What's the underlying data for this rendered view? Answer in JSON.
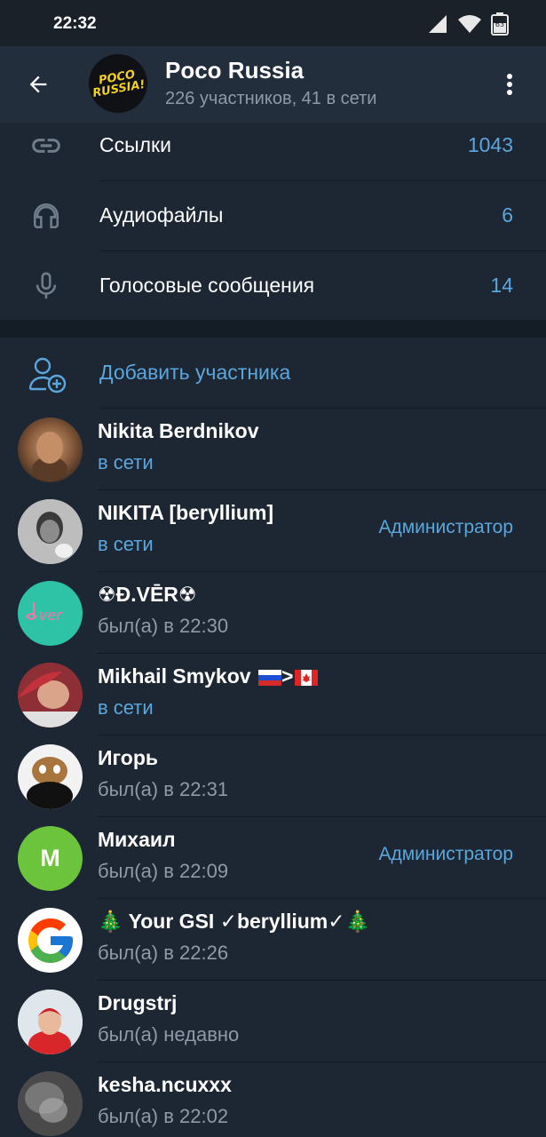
{
  "status_bar": {
    "time": "22:32",
    "battery": "63",
    "icons": [
      "signal-icon",
      "wifi-icon",
      "battery-icon"
    ]
  },
  "header": {
    "title": "Poco Russia",
    "subtitle": "226 участников, 41 в сети",
    "avatar_text_line1": "POCO",
    "avatar_text_line2": "RUSSIA!"
  },
  "media": [
    {
      "label": "Ссылки",
      "count": "1043",
      "icon": "link-icon"
    },
    {
      "label": "Аудиофайлы",
      "count": "6",
      "icon": "headphones-icon"
    },
    {
      "label": "Голосовые сообщения",
      "count": "14",
      "icon": "microphone-icon"
    }
  ],
  "add_member": {
    "label": "Добавить участника"
  },
  "members": [
    {
      "name": "Nikita Berdnikov",
      "status": "в сети",
      "online": true,
      "role": ""
    },
    {
      "name": "NIKITA [beryllium]",
      "status": "в сети",
      "online": true,
      "role": "Администратор"
    },
    {
      "name": "☢Đ.VĒR☢",
      "status": "был(а) в 22:30",
      "online": false,
      "role": ""
    },
    {
      "name": "Mikhail Smykov ",
      "name_suffix": ">",
      "status": "в сети",
      "online": true,
      "role": ""
    },
    {
      "name": "Игорь",
      "status": "был(а) в 22:31",
      "online": false,
      "role": ""
    },
    {
      "name": "Михаил",
      "status": "был(а) в 22:09",
      "online": false,
      "role": "Администратор",
      "avatar_letter": "M"
    },
    {
      "name": "🎄 Your GSI ✓beryllium✓🎄",
      "status": "был(а) в 22:26",
      "online": false,
      "role": ""
    },
    {
      "name": "Drugstrj",
      "status": "был(а) недавно",
      "online": false,
      "role": ""
    },
    {
      "name": "kesha.ncuxxx",
      "status": "был(а) в 22:02",
      "online": false,
      "role": ""
    }
  ],
  "colors": {
    "accent": "#5aa6dd",
    "background": "#1d2733",
    "header": "#232e3c",
    "secondary_text": "#8e9aa8"
  }
}
